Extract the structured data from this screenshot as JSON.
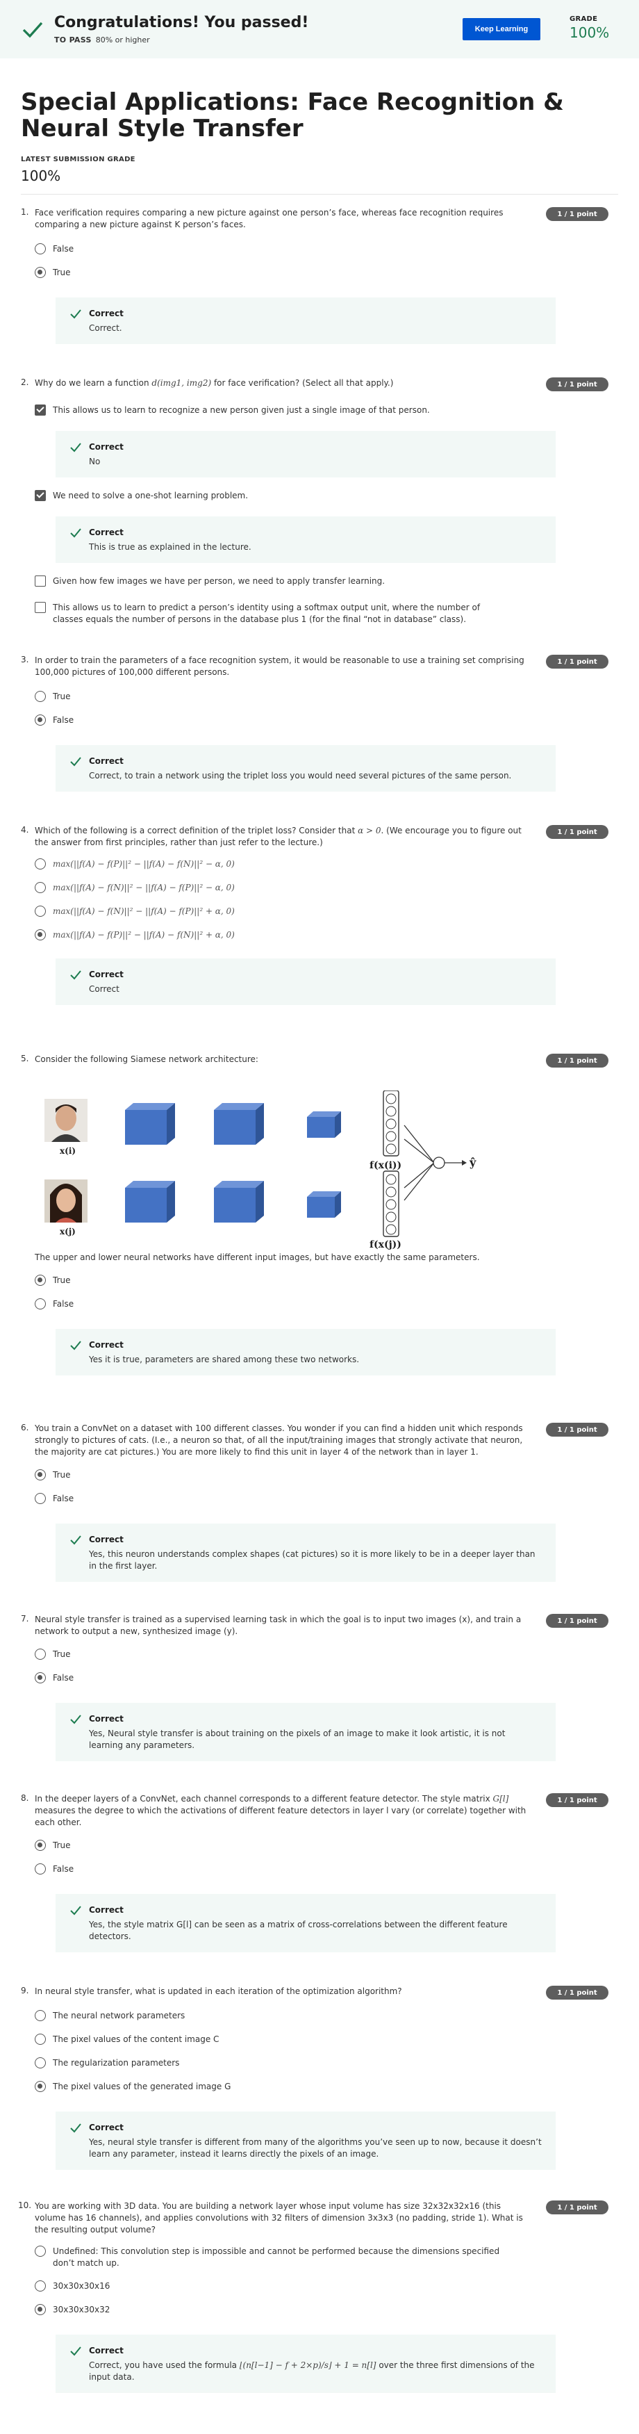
{
  "banner": {
    "title": "Congratulations! You passed!",
    "to_pass_label": "TO PASS",
    "to_pass_value": "80% or higher",
    "keep_learning": "Keep Learning",
    "grade_label": "GRADE",
    "grade_value": "100%"
  },
  "page": {
    "title": "Special Applications: Face Recognition & Neural Style Transfer",
    "latest_label": "LATEST SUBMISSION GRADE",
    "latest_value": "100%"
  },
  "points": "1 / 1 point",
  "questions": [
    {
      "num": "1.",
      "text": "Face verification requires comparing a new picture against one person’s face, whereas face recognition requires comparing a new picture against K person’s faces.",
      "options": [
        "False",
        "True"
      ],
      "feedback": [
        {
          "title": "Correct",
          "msg": "Correct."
        }
      ]
    },
    {
      "num": "2.",
      "text_pre": "Why do we learn a function ",
      "text_math": "d(img1, img2)",
      "text_post": " for face verification? (Select all that apply.)",
      "options": [
        "This allows us to learn to recognize a new person given just a single image of that person.",
        "We need to solve a one-shot learning problem.",
        "Given how few images we have per person, we need to apply transfer learning.",
        "This allows us to learn to predict a person’s identity using a softmax output unit, where the number of classes equals the number of persons in the database plus 1 (for the final “not in database” class)."
      ],
      "feedback": [
        {
          "title": "Correct",
          "msg": "No"
        },
        {
          "title": "Correct",
          "msg": "This is true as explained in the lecture."
        }
      ]
    },
    {
      "num": "3.",
      "text": "In order to train the parameters of a face recognition system, it would be reasonable to use a training set comprising 100,000 pictures of 100,000 different persons.",
      "options": [
        "True",
        "False"
      ],
      "feedback": [
        {
          "title": "Correct",
          "msg": "Correct, to train a network using the triplet loss you would need several pictures of the same person."
        }
      ]
    },
    {
      "num": "4.",
      "text_pre": "Which of the following is a correct definition of the triplet loss? Consider that ",
      "text_math": "α > 0",
      "text_post": ". (We encourage you to figure out the answer from first principles, rather than just refer to the lecture.)",
      "options": [
        "max(||f(A) − f(P)||² − ||f(A) − f(N)||² − α, 0)",
        "max(||f(A) − f(N)||² − ||f(A) − f(P)||² − α, 0)",
        "max(||f(A) − f(N)||² − ||f(A) − f(P)||² + α, 0)",
        "max(||f(A) − f(P)||² − ||f(A) − f(N)||² + α, 0)"
      ],
      "feedback": [
        {
          "title": "Correct",
          "msg": "Correct"
        }
      ]
    },
    {
      "num": "5.",
      "text": "Consider the following Siamese network architecture:",
      "text2": "The upper and lower neural networks have different input images, but have exactly the same parameters.",
      "labels": [
        "x(i)",
        "x(j)",
        "f(x(i))",
        "f(x(j))",
        "ŷ"
      ],
      "options": [
        "True",
        "False"
      ],
      "feedback": [
        {
          "title": "Correct",
          "msg": "Yes it is true, parameters are shared among these two networks."
        }
      ]
    },
    {
      "num": "6.",
      "text": "You train a ConvNet on a dataset with 100 different classes. You wonder if you can find a hidden unit which responds strongly to pictures of cats. (I.e., a neuron so that, of all the input/training images that strongly activate that neuron, the majority are cat pictures.) You are more likely to find this unit in layer 4 of the network than in layer 1.",
      "options": [
        "True",
        "False"
      ],
      "feedback": [
        {
          "title": "Correct",
          "msg": "Yes, this neuron understands complex shapes (cat pictures) so it is more likely to be in a deeper layer than in the first layer."
        }
      ]
    },
    {
      "num": "7.",
      "text": "Neural style transfer is trained as a supervised learning task in which the goal is to input two images (x), and train a network to output a new, synthesized image (y).",
      "options": [
        "True",
        "False"
      ],
      "feedback": [
        {
          "title": "Correct",
          "msg": "Yes, Neural style transfer is about training on the pixels of an image to make it look artistic, it is not learning any parameters."
        }
      ]
    },
    {
      "num": "8.",
      "text_pre": "In the deeper layers of a ConvNet, each channel corresponds to a different feature detector. The style matrix ",
      "text_math": "G[l]",
      "text_post": " measures the degree to which the activations of different feature detectors in layer l vary (or correlate) together with each other.",
      "options": [
        "True",
        "False"
      ],
      "feedback": [
        {
          "title": "Correct",
          "msg": "Yes, the style matrix G[l] can be seen as a matrix of cross-correlations between the different feature detectors."
        }
      ]
    },
    {
      "num": "9.",
      "text": "In neural style transfer, what is updated in each iteration of the optimization algorithm?",
      "options": [
        "The neural network parameters",
        "The pixel values of the content image C",
        "The regularization parameters",
        "The pixel values of the generated image G"
      ],
      "feedback": [
        {
          "title": "Correct",
          "msg": "Yes, neural style transfer is different from many of the algorithms you’ve seen up to now, because it doesn’t learn any parameter, instead it learns directly the pixels of an image."
        }
      ]
    },
    {
      "num": "10.",
      "text": "You are working with 3D data. You are building a network layer whose input volume has size 32x32x32x16 (this volume has 16 channels), and applies convolutions with 32 filters of dimension 3x3x3 (no padding, stride 1). What is the resulting output volume?",
      "options": [
        "Undefined: This convolution step is impossible and cannot be performed because the dimensions specified don’t match up.",
        "30x30x30x16",
        "30x30x30x32"
      ],
      "feedback": [
        {
          "title": "Correct",
          "msg_pre": "Correct, you have used the formula ",
          "msg_math": "⌊(n[l−1] − f + 2×p)/s⌋ + 1 = n[l]",
          "msg_post": " over the three first dimensions of the input data."
        }
      ]
    }
  ],
  "colors": {
    "brand_blue": "#0056d2",
    "success_green": "#1d7c50",
    "feedback_bg": "#f2f8f6",
    "badge_gray": "#5e5e5e",
    "cube_blue": "#4472c4"
  }
}
